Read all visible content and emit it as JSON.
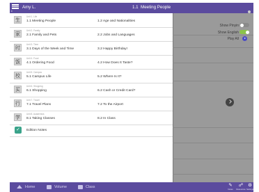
{
  "header": {
    "user": "Amy L.",
    "title": "1.1  Meeting People"
  },
  "drawer": {
    "chapters": [
      {
        "unit": "Unit 1. Life",
        "lesson1": "1.1 Meeting People",
        "lesson2": "1.2 Age and Nationalities",
        "icon_text": "生"
      },
      {
        "unit": "Unit 2. Family",
        "lesson1": "2.1 Family and Pets",
        "lesson2": "2.2 Jobs and Languages",
        "icon_text": "家"
      },
      {
        "unit": "Unit 3. Time",
        "lesson1": "3.1 Days of the Week and Time",
        "lesson2": "3.2 Happy Birthday!",
        "icon_text": "时"
      },
      {
        "unit": "Unit 4. Food",
        "lesson1": "4.1 Ordering Food",
        "lesson2": "4.2 How Does It Taste?",
        "icon_text": "饭"
      },
      {
        "unit": "Unit 5. Campus",
        "lesson1": "5.1 Campus Life",
        "lesson2": "5.2 Where Is It?",
        "icon_text": "校"
      },
      {
        "unit": "Unit 6. Shopping",
        "lesson1": "6.1 Shopping",
        "lesson2": "6.2 Cash or Credit Card?",
        "icon_text": "买"
      },
      {
        "unit": "Unit 7. Travel",
        "lesson1": "7.1 Travel Plans",
        "lesson2": "7.2 To the Airport",
        "icon_text": "行"
      },
      {
        "unit": "Unit 8. Academics",
        "lesson1": "8.1 Taking Classes",
        "lesson2": "8.2 In Class",
        "icon_text": "学"
      }
    ],
    "notes_label": "Edition Notes"
  },
  "panel": {
    "show_pinyin_label": "Show Pinyin",
    "show_pinyin_on": false,
    "show_english_label": "Show English",
    "show_english_on": true,
    "play_all_label": "Play All"
  },
  "bottom_nav": {
    "home": "Home",
    "volume": "Volume",
    "class": "Class",
    "right_icons": [
      {
        "name": "Notes",
        "glyph": "✎"
      },
      {
        "name": "Resources",
        "glyph": "☍"
      },
      {
        "name": "Settings",
        "glyph": "⚙"
      }
    ]
  },
  "colors": {
    "header_bg": "#5b4b9e",
    "toggle_on": "#8bc34a",
    "toggle_off": "#8a8a8a",
    "play": "#4b4bc4",
    "notes_icon": "#3aa38a"
  }
}
